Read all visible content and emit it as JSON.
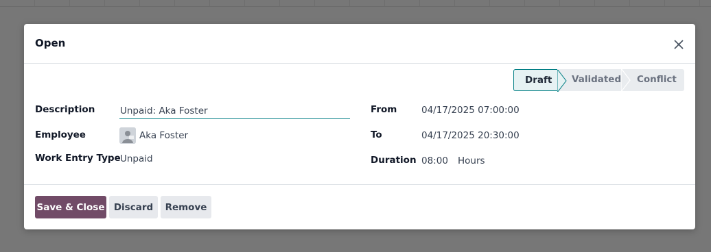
{
  "dialog": {
    "title": "Open",
    "close_icon": "close-icon"
  },
  "status": {
    "steps": [
      "Draft",
      "Validated",
      "Conflict"
    ],
    "active": "Draft",
    "active_color": "#017e84"
  },
  "form": {
    "description_label": "Description",
    "description_value": "Unpaid: Aka Foster",
    "employee_label": "Employee",
    "employee_name": "Aka Foster",
    "work_entry_type_label": "Work Entry Type",
    "work_entry_type_value": "Unpaid",
    "from_label": "From",
    "from_value": "04/17/2025 07:00:00",
    "to_label": "To",
    "to_value": "04/17/2025 20:30:00",
    "duration_label": "Duration",
    "duration_value": "08:00",
    "duration_unit": "Hours"
  },
  "footer": {
    "save_label": "Save & Close",
    "discard_label": "Discard",
    "remove_label": "Remove"
  },
  "colors": {
    "primary": "#714b67",
    "accent": "#017e84",
    "backdrop": "#777777"
  }
}
